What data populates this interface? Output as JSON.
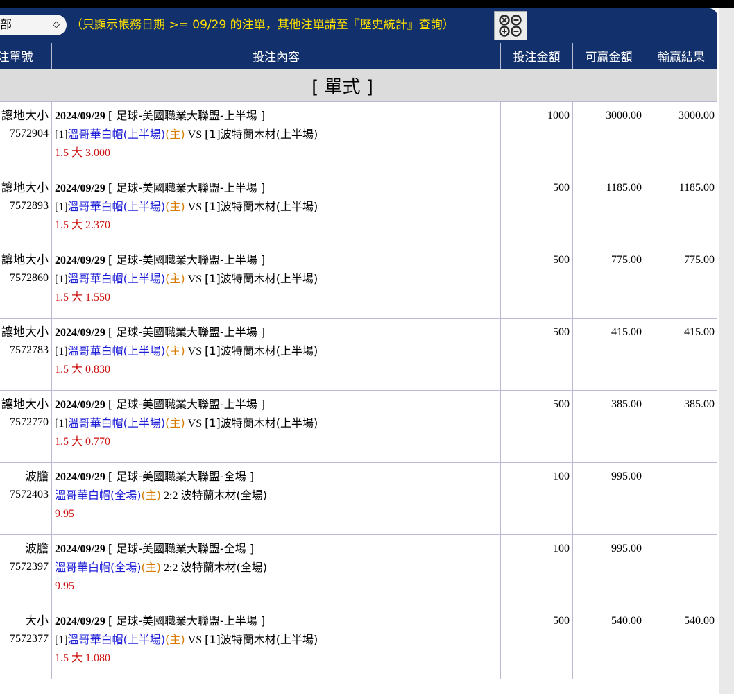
{
  "toolbar": {
    "filter_value": "部",
    "notice": "（只顯示帳務日期 >= 09/29 的注單，其他注單請至『歷史統計』查詢）"
  },
  "table": {
    "headers": [
      "投注單號",
      "投注內容",
      "投注金額",
      "可贏金額",
      "輸贏結果"
    ],
    "section_label": "[ 單式 ]",
    "rows": [
      {
        "type": "讓地大小",
        "id": "7572904",
        "date": "2024/09/29",
        "league": "[ 足球-美國職業大聯盟-上半場 ]",
        "prefix": "[1]",
        "home": "溫哥華白帽(上半場)",
        "home_tag": "(主)",
        "vs": " VS ",
        "away": "[1]波特蘭木材(上半場)",
        "pick": "1.5 大 3.000",
        "stake": "1000",
        "win": "3000.00",
        "result": "3000.00"
      },
      {
        "type": "讓地大小",
        "id": "7572893",
        "date": "2024/09/29",
        "league": "[ 足球-美國職業大聯盟-上半場 ]",
        "prefix": "[1]",
        "home": "溫哥華白帽(上半場)",
        "home_tag": "(主)",
        "vs": " VS ",
        "away": "[1]波特蘭木材(上半場)",
        "pick": "1.5 大 2.370",
        "stake": "500",
        "win": "1185.00",
        "result": "1185.00"
      },
      {
        "type": "讓地大小",
        "id": "7572860",
        "date": "2024/09/29",
        "league": "[ 足球-美國職業大聯盟-上半場 ]",
        "prefix": "[1]",
        "home": "溫哥華白帽(上半場)",
        "home_tag": "(主)",
        "vs": " VS ",
        "away": "[1]波特蘭木材(上半場)",
        "pick": "1.5 大 1.550",
        "stake": "500",
        "win": "775.00",
        "result": "775.00"
      },
      {
        "type": "讓地大小",
        "id": "7572783",
        "date": "2024/09/29",
        "league": "[ 足球-美國職業大聯盟-上半場 ]",
        "prefix": "[1]",
        "home": "溫哥華白帽(上半場)",
        "home_tag": "(主)",
        "vs": " VS ",
        "away": "[1]波特蘭木材(上半場)",
        "pick": "1.5 大 0.830",
        "stake": "500",
        "win": "415.00",
        "result": "415.00"
      },
      {
        "type": "讓地大小",
        "id": "7572770",
        "date": "2024/09/29",
        "league": "[ 足球-美國職業大聯盟-上半場 ]",
        "prefix": "[1]",
        "home": "溫哥華白帽(上半場)",
        "home_tag": "(主)",
        "vs": " VS ",
        "away": "[1]波特蘭木材(上半場)",
        "pick": "1.5 大 0.770",
        "stake": "500",
        "win": "385.00",
        "result": "385.00"
      },
      {
        "type": "波膽",
        "id": "7572403",
        "date": "2024/09/29",
        "league": "[ 足球-美國職業大聯盟-全場 ]",
        "prefix": "",
        "home": "溫哥華白帽(全場)",
        "home_tag": "(主)",
        "vs": " 2:2 ",
        "away": "波特蘭木材(全場)",
        "pick": "9.95",
        "stake": "100",
        "win": "995.00",
        "result": ""
      },
      {
        "type": "波膽",
        "id": "7572397",
        "date": "2024/09/29",
        "league": "[ 足球-美國職業大聯盟-全場 ]",
        "prefix": "",
        "home": "溫哥華白帽(全場)",
        "home_tag": "(主)",
        "vs": " 2:2 ",
        "away": "波特蘭木材(全場)",
        "pick": "9.95",
        "stake": "100",
        "win": "995.00",
        "result": ""
      },
      {
        "type": "大小",
        "id": "7572377",
        "date": "2024/09/29",
        "league": "[ 足球-美國職業大聯盟-上半場 ]",
        "prefix": "[1]",
        "home": "溫哥華白帽(上半場)",
        "home_tag": "(主)",
        "vs": " VS ",
        "away": "[1]波特蘭木材(上半場)",
        "pick": "1.5 大 1.080",
        "stake": "500",
        "win": "540.00",
        "result": "540.00"
      }
    ]
  },
  "colors": {
    "header_bg": "#12306b",
    "notice_text": "#ffe100",
    "team_blue": "#1f1fd8",
    "home_tag_orange": "#d77b00",
    "pick_red": "#cc1111",
    "result_green": "#1c8a1c"
  },
  "icons": {
    "view_toggle": "grid-circles-icon",
    "select_chevron": "chevron-updown-icon"
  }
}
